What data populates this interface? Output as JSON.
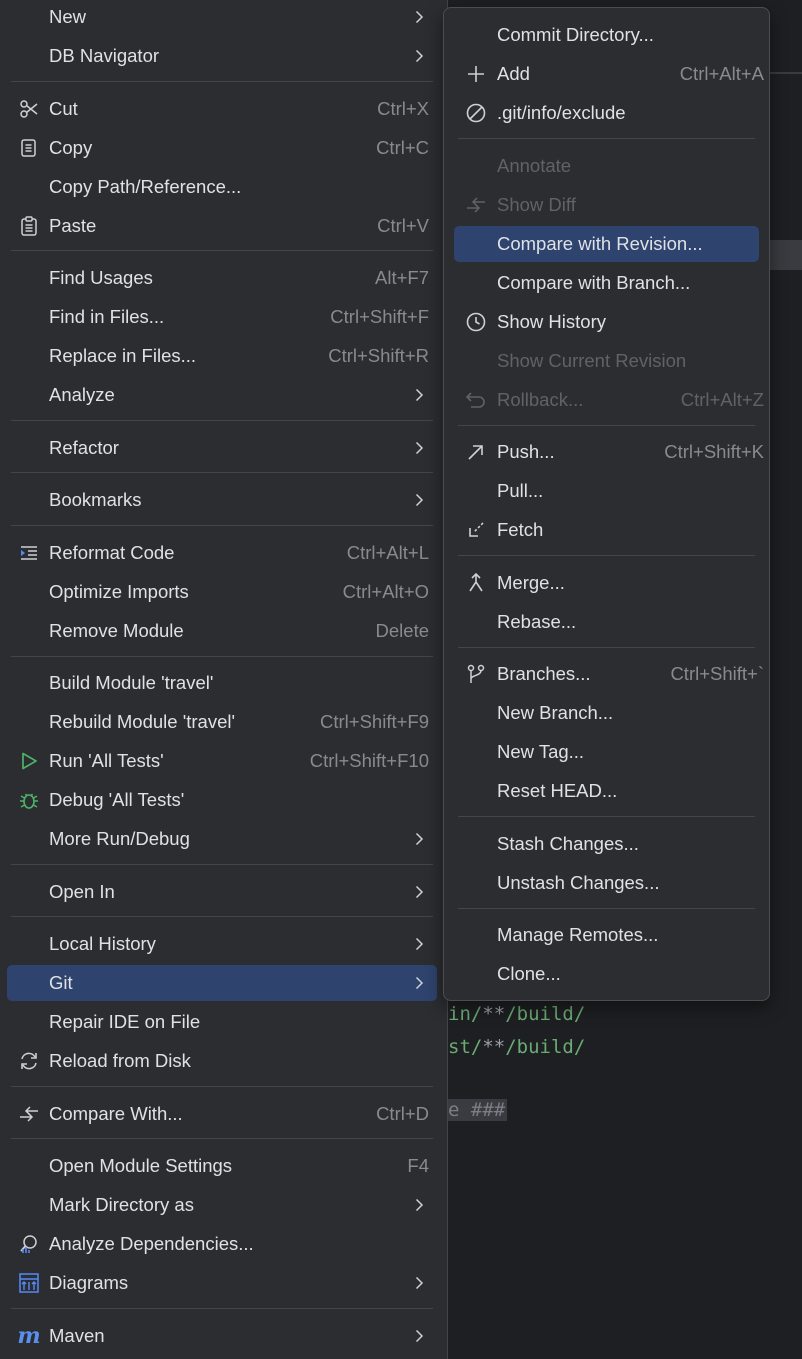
{
  "colors": {
    "menu_bg": "#2b2d30",
    "selected_bg": "#2e436e",
    "text": "#dfe1e5",
    "shortcut": "#878a90",
    "disabled": "#5f6268",
    "code_green": "#6aab73",
    "run_icon_green": "#4fb168",
    "maven_blue": "#5a8ff0"
  },
  "editor": {
    "line1_a": "in/",
    "line1_b": "**",
    "line1_c": "/build/",
    "line2_a": "st/",
    "line2_b": "**",
    "line2_c": "/build/",
    "line3": "e ###"
  },
  "main_menu": {
    "items": [
      {
        "label": "New",
        "shortcut": "",
        "icon": "",
        "submenu": true
      },
      {
        "label": "DB Navigator",
        "shortcut": "",
        "icon": "",
        "submenu": true
      },
      {
        "label": "Cut",
        "shortcut": "Ctrl+X",
        "icon": "scissors-icon",
        "submenu": false
      },
      {
        "label": "Copy",
        "shortcut": "Ctrl+C",
        "icon": "copy-icon",
        "submenu": false
      },
      {
        "label": "Copy Path/Reference...",
        "shortcut": "",
        "icon": "",
        "submenu": false
      },
      {
        "label": "Paste",
        "shortcut": "Ctrl+V",
        "icon": "paste-icon",
        "submenu": false
      },
      {
        "label": "Find Usages",
        "shortcut": "Alt+F7",
        "icon": "",
        "submenu": false
      },
      {
        "label": "Find in Files...",
        "shortcut": "Ctrl+Shift+F",
        "icon": "",
        "submenu": false
      },
      {
        "label": "Replace in Files...",
        "shortcut": "Ctrl+Shift+R",
        "icon": "",
        "submenu": false
      },
      {
        "label": "Analyze",
        "shortcut": "",
        "icon": "",
        "submenu": true
      },
      {
        "label": "Refactor",
        "shortcut": "",
        "icon": "",
        "submenu": true
      },
      {
        "label": "Bookmarks",
        "shortcut": "",
        "icon": "",
        "submenu": true
      },
      {
        "label": "Reformat Code",
        "shortcut": "Ctrl+Alt+L",
        "icon": "reformat-icon",
        "submenu": false
      },
      {
        "label": "Optimize Imports",
        "shortcut": "Ctrl+Alt+O",
        "icon": "",
        "submenu": false
      },
      {
        "label": "Remove Module",
        "shortcut": "Delete",
        "icon": "",
        "submenu": false
      },
      {
        "label": "Build Module 'travel'",
        "shortcut": "",
        "icon": "",
        "submenu": false
      },
      {
        "label": "Rebuild Module 'travel'",
        "shortcut": "Ctrl+Shift+F9",
        "icon": "",
        "submenu": false
      },
      {
        "label": "Run 'All Tests'",
        "shortcut": "Ctrl+Shift+F10",
        "icon": "run-icon",
        "submenu": false
      },
      {
        "label": "Debug 'All Tests'",
        "shortcut": "",
        "icon": "debug-icon",
        "submenu": false
      },
      {
        "label": "More Run/Debug",
        "shortcut": "",
        "icon": "",
        "submenu": true
      },
      {
        "label": "Open In",
        "shortcut": "",
        "icon": "",
        "submenu": true
      },
      {
        "label": "Local History",
        "shortcut": "",
        "icon": "",
        "submenu": true
      },
      {
        "label": "Git",
        "shortcut": "",
        "icon": "",
        "submenu": true
      },
      {
        "label": "Repair IDE on File",
        "shortcut": "",
        "icon": "",
        "submenu": false
      },
      {
        "label": "Reload from Disk",
        "shortcut": "",
        "icon": "reload-icon",
        "submenu": false
      },
      {
        "label": "Compare With...",
        "shortcut": "Ctrl+D",
        "icon": "compare-icon",
        "submenu": false
      },
      {
        "label": "Open Module Settings",
        "shortcut": "F4",
        "icon": "",
        "submenu": false
      },
      {
        "label": "Mark Directory as",
        "shortcut": "",
        "icon": "",
        "submenu": true
      },
      {
        "label": "Analyze Dependencies...",
        "shortcut": "",
        "icon": "dependencies-icon",
        "submenu": false
      },
      {
        "label": "Diagrams",
        "shortcut": "",
        "icon": "diagrams-icon",
        "submenu": true
      },
      {
        "label": "Maven",
        "shortcut": "",
        "icon": "maven-icon",
        "submenu": true
      }
    ]
  },
  "git_menu": {
    "items": [
      {
        "label": "Commit Directory...",
        "shortcut": "",
        "icon": "",
        "disabled": false
      },
      {
        "label": "Add",
        "shortcut": "Ctrl+Alt+A",
        "icon": "plus-icon",
        "disabled": false
      },
      {
        "label": ".git/info/exclude",
        "shortcut": "",
        "icon": "ignore-icon",
        "disabled": false
      },
      {
        "label": "Annotate",
        "shortcut": "",
        "icon": "",
        "disabled": true
      },
      {
        "label": "Show Diff",
        "shortcut": "",
        "icon": "diff-icon",
        "disabled": true
      },
      {
        "label": "Compare with Revision...",
        "shortcut": "",
        "icon": "",
        "disabled": false
      },
      {
        "label": "Compare with Branch...",
        "shortcut": "",
        "icon": "",
        "disabled": false
      },
      {
        "label": "Show History",
        "shortcut": "",
        "icon": "clock-icon",
        "disabled": false
      },
      {
        "label": "Show Current Revision",
        "shortcut": "",
        "icon": "",
        "disabled": true
      },
      {
        "label": "Rollback...",
        "shortcut": "Ctrl+Alt+Z",
        "icon": "rollback-icon",
        "disabled": true
      },
      {
        "label": "Push...",
        "shortcut": "Ctrl+Shift+K",
        "icon": "push-icon",
        "disabled": false
      },
      {
        "label": "Pull...",
        "shortcut": "",
        "icon": "",
        "disabled": false
      },
      {
        "label": "Fetch",
        "shortcut": "",
        "icon": "fetch-icon",
        "disabled": false
      },
      {
        "label": "Merge...",
        "shortcut": "",
        "icon": "merge-icon",
        "disabled": false
      },
      {
        "label": "Rebase...",
        "shortcut": "",
        "icon": "",
        "disabled": false
      },
      {
        "label": "Branches...",
        "shortcut": "Ctrl+Shift+`",
        "icon": "branch-icon",
        "disabled": false
      },
      {
        "label": "New Branch...",
        "shortcut": "",
        "icon": "",
        "disabled": false
      },
      {
        "label": "New Tag...",
        "shortcut": "",
        "icon": "",
        "disabled": false
      },
      {
        "label": "Reset HEAD...",
        "shortcut": "",
        "icon": "",
        "disabled": false
      },
      {
        "label": "Stash Changes...",
        "shortcut": "",
        "icon": "",
        "disabled": false
      },
      {
        "label": "Unstash Changes...",
        "shortcut": "",
        "icon": "",
        "disabled": false
      },
      {
        "label": "Manage Remotes...",
        "shortcut": "",
        "icon": "",
        "disabled": false
      },
      {
        "label": "Clone...",
        "shortcut": "",
        "icon": "",
        "disabled": false
      }
    ]
  }
}
